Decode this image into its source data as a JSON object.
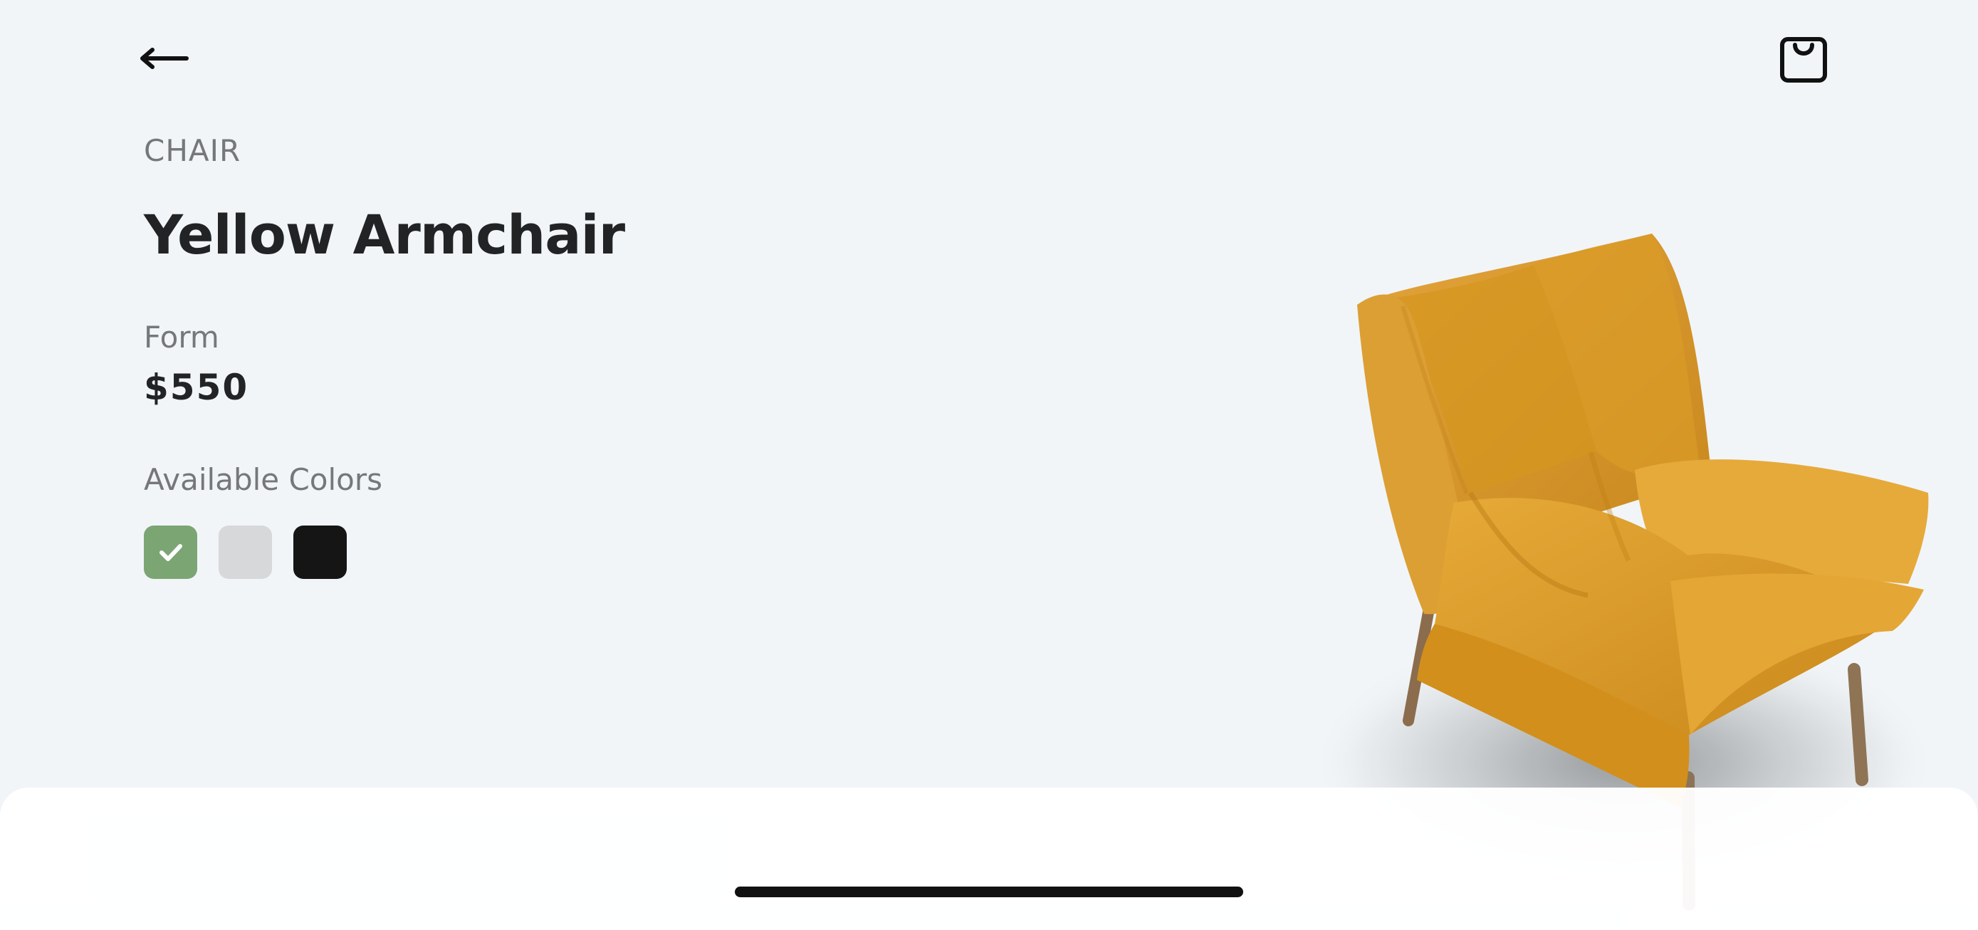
{
  "header": {
    "back_icon": "arrow-left-icon",
    "cart_icon": "shopping-bag-icon"
  },
  "product": {
    "category": "CHAIR",
    "name": "Yellow Armchair",
    "form_label": "Form",
    "price": "$550",
    "colors_label": "Available Colors",
    "image_icon": "armchair-image"
  },
  "colors": [
    {
      "hex": "#7ca574",
      "selected": true,
      "icon": "check-icon"
    },
    {
      "hex": "#d7d8da",
      "selected": false
    },
    {
      "hex": "#151515",
      "selected": false
    }
  ]
}
